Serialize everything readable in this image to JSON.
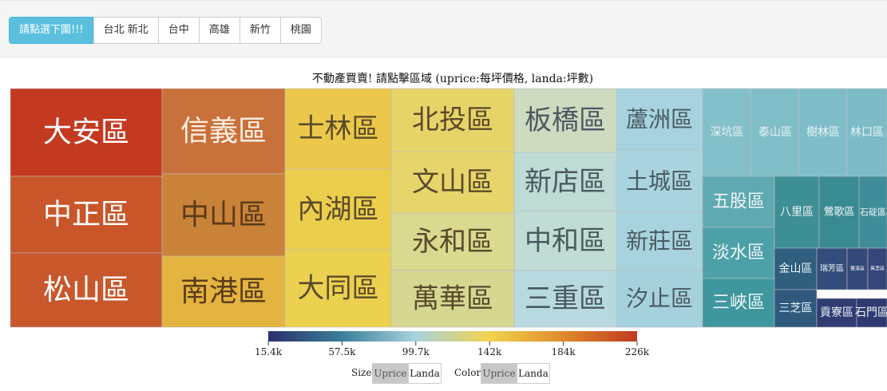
{
  "nav": {
    "buttons": [
      {
        "label": "請點選下圖!!!",
        "style": "primary"
      },
      {
        "label": "台北 新北",
        "style": "default"
      },
      {
        "label": "台中",
        "style": "default"
      },
      {
        "label": "高雄",
        "style": "default"
      },
      {
        "label": "新竹",
        "style": "default"
      },
      {
        "label": "桃園",
        "style": "default"
      }
    ]
  },
  "chart_data": {
    "type": "treemap",
    "title": "不動產買賣! 請點擊區域 (uprice:每坪價格, landa:坪數)",
    "color_scale": {
      "ticks": [
        "15.4k",
        "57.5k",
        "99.7k",
        "142k",
        "184k",
        "226k"
      ],
      "colors": [
        "#2b2f6f",
        "#3a7f9a",
        "#a8d3dc",
        "#f2d34e",
        "#e08a2b",
        "#c0391f"
      ]
    },
    "cells": [
      {
        "name": "大安區",
        "color": "#c43a21"
      },
      {
        "name": "中正區",
        "color": "#c9562a"
      },
      {
        "name": "松山區",
        "color": "#c9572c"
      },
      {
        "name": "信義區",
        "color": "#c9713a"
      },
      {
        "name": "中山區",
        "color": "#c98338"
      },
      {
        "name": "南港區",
        "color": "#e3b43f"
      },
      {
        "name": "士林區",
        "color": "#ebc84b"
      },
      {
        "name": "內湖區",
        "color": "#ecce4d"
      },
      {
        "name": "大同區",
        "color": "#ecd050"
      },
      {
        "name": "北投區",
        "color": "#e7d469"
      },
      {
        "name": "文山區",
        "color": "#e6d56b"
      },
      {
        "name": "永和區",
        "color": "#d9d98f"
      },
      {
        "name": "萬華區",
        "color": "#d6d892"
      },
      {
        "name": "板橋區",
        "color": "#cfdbc0"
      },
      {
        "name": "新店區",
        "color": "#bedbd5"
      },
      {
        "name": "中和區",
        "color": "#c1dcd4"
      },
      {
        "name": "三重區",
        "color": "#b8d9e0"
      },
      {
        "name": "蘆洲區",
        "color": "#a6d3df"
      },
      {
        "name": "土城區",
        "color": "#a9d4df"
      },
      {
        "name": "新莊區",
        "color": "#a7d3de"
      },
      {
        "name": "汐止區",
        "color": "#a5d1dd"
      },
      {
        "name": "深坑區",
        "color": "#83c0ca"
      },
      {
        "name": "泰山區",
        "color": "#80bec8"
      },
      {
        "name": "樹林區",
        "color": "#7fbec8"
      },
      {
        "name": "林口區",
        "color": "#7dbcc7"
      },
      {
        "name": "五股區",
        "color": "#5fa9b0"
      },
      {
        "name": "淡水區",
        "color": "#4ea0a8"
      },
      {
        "name": "三峽區",
        "color": "#3f979e"
      },
      {
        "name": "八里區",
        "color": "#3d8f94"
      },
      {
        "name": "鶯歌區",
        "color": "#3a8a92"
      },
      {
        "name": "石碇區",
        "color": "#3f8d99"
      },
      {
        "name": "金山區",
        "color": "#2f5e7f"
      },
      {
        "name": "瑞芳區",
        "color": "#334d7b"
      },
      {
        "name": "雙溪區",
        "color": "#34497a"
      },
      {
        "name": "萬里區",
        "color": "#36457a"
      },
      {
        "name": "三芝區",
        "color": "#2f5a7e"
      },
      {
        "name": "貢寮區",
        "color": "#313c74"
      },
      {
        "name": "石門區",
        "color": "#2f3a72"
      }
    ]
  },
  "controls": {
    "size_label": "Size",
    "color_label": "Color",
    "size_options": [
      "Uprice",
      "Landa"
    ],
    "color_options": [
      "Uprice",
      "Landa"
    ],
    "size_selected": "Uprice",
    "color_selected": "Uprice"
  }
}
